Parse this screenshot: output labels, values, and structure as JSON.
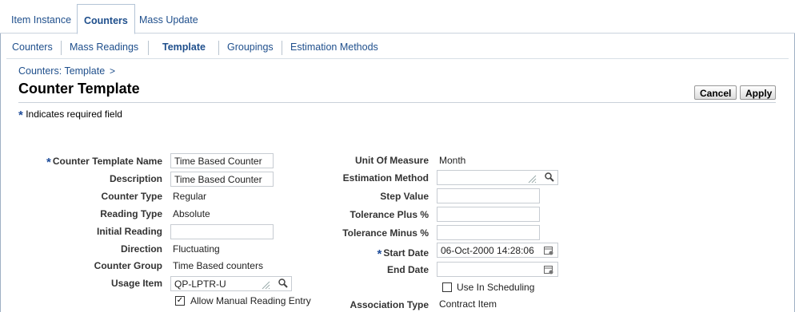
{
  "tabs": [
    {
      "label": "Item Instance"
    },
    {
      "label": "Counters"
    },
    {
      "label": "Mass Update"
    }
  ],
  "subnav": [
    {
      "label": "Counters"
    },
    {
      "label": "Mass Readings"
    },
    {
      "label": "Template"
    },
    {
      "label": "Groupings"
    },
    {
      "label": "Estimation Methods"
    }
  ],
  "breadcrumb": {
    "link": "Counters: Template",
    "separator": ">"
  },
  "page": {
    "title": "Counter Template",
    "required_note": "Indicates required field",
    "required_star": "*"
  },
  "buttons": {
    "cancel": "Cancel",
    "apply": "Apply"
  },
  "left_form": {
    "counter_template_name": {
      "label": "Counter Template Name",
      "value": "Time Based Counter"
    },
    "description": {
      "label": "Description",
      "value": "Time Based Counter"
    },
    "counter_type": {
      "label": "Counter Type",
      "value": "Regular"
    },
    "reading_type": {
      "label": "Reading Type",
      "value": "Absolute"
    },
    "initial_reading": {
      "label": "Initial Reading",
      "value": ""
    },
    "direction": {
      "label": "Direction",
      "value": "Fluctuating"
    },
    "counter_group": {
      "label": "Counter Group",
      "value": "Time Based counters"
    },
    "usage_item": {
      "label": "Usage Item",
      "value": "QP-LPTR-U"
    },
    "allow_manual": {
      "label": "Allow Manual Reading Entry",
      "checked": true
    }
  },
  "right_form": {
    "unit_of_measure": {
      "label": "Unit Of Measure",
      "value": "Month"
    },
    "estimation_method": {
      "label": "Estimation Method",
      "value": ""
    },
    "step_value": {
      "label": "Step Value",
      "value": ""
    },
    "tolerance_plus": {
      "label": "Tolerance Plus %",
      "value": ""
    },
    "tolerance_minus": {
      "label": "Tolerance Minus %",
      "value": ""
    },
    "start_date": {
      "label": "Start Date",
      "value": "06-Oct-2000 14:28:06"
    },
    "end_date": {
      "label": "End Date",
      "value": ""
    },
    "use_in_scheduling": {
      "label": "Use In Scheduling",
      "checked": false
    },
    "association_type": {
      "label": "Association Type",
      "value": "Contract Item"
    }
  },
  "colors": {
    "link": "#1f4f8c",
    "required_star": "#1e4c9a"
  }
}
